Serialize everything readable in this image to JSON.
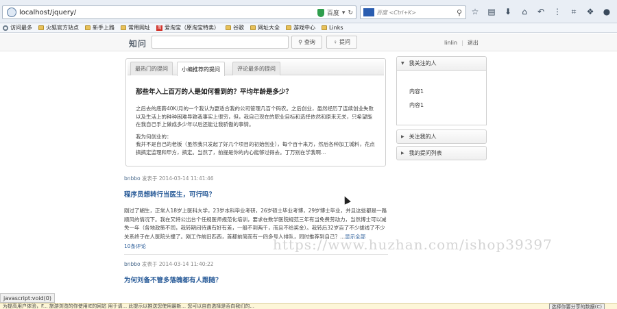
{
  "browser": {
    "url": "localhost/jquery/",
    "search_placeholder": "百度 <Ctrl+K>",
    "url_action": "百度"
  },
  "bookmarks": [
    {
      "label": "访问最多",
      "icon": "gear"
    },
    {
      "label": "火狐官方站点",
      "icon": "folder"
    },
    {
      "label": "新手上路",
      "icon": "folder"
    },
    {
      "label": "常用网址",
      "icon": "folder"
    },
    {
      "label": "爱淘宝（原淘宝特卖）",
      "icon": "taobao"
    },
    {
      "label": "谷歌",
      "icon": "folder"
    },
    {
      "label": "网址大全",
      "icon": "folder"
    },
    {
      "label": "游戏中心",
      "icon": "folder"
    },
    {
      "label": "Links",
      "icon": "folder"
    }
  ],
  "site": {
    "logo": "知问",
    "search_button": "查询",
    "ask_button": "提问",
    "username": "linlin",
    "logout": "退出"
  },
  "tabs": [
    {
      "label": "最热门的提问"
    },
    {
      "label": "小编推荐的提问"
    },
    {
      "label": "评论最多的提问"
    }
  ],
  "featured": {
    "title": "那些年入上百万的人是如何看到的？平均年龄是多少？",
    "para1": "之后去的底薪40K/月的一个我认为更适合我的公司管理几百个码农。之后创业，虽然经历了连续创业失败以及生活上的种种困难导致我事实上很穷，但，我自己现在的职业目标和选择依然和原来无关，只希望能在我自己手上做成多少年以后还能让我骄傲的事情。",
    "para2": "我为何创业的：",
    "para3": "我并不是自己的老板（虽然我只发起了好几个项目的初始创业），每个百十来万，然后各种加工城料，花点搞搞定监理和甲方，搞定。当然了，前提是你的内心能够过得去。丁万别在学我啊…"
  },
  "feed": [
    {
      "author": "bnbbo",
      "verb": "发表于",
      "time": "2014-03-14 11:41:46",
      "title": "程序员想转行当医生，可行吗？",
      "body": "刚过了糊生，正常人18岁上医科大学，23岁本科毕业考研，26岁硕士毕业考博，29岁博士毕业，并且这些都是一路顺风的情况下。我在又特公出台个任规医师规范化培训，要求在数学医院规范三年有当免费劳动力，当然博士可以减免一年（各地政策不同，我转期间待遇有好有差，一般不到两千，而且不给奖金）。我转后32岁百了不少拔线了不少关系终于在人医院头撞了。刚工作前旧匹西，首都前简而有一四多号人排队，同时推荐到自己？...",
      "more": "显示全部",
      "comments": "10条评论"
    },
    {
      "author": "bnbbo",
      "verb": "发表于",
      "time": "2014-03-14 11:40:22",
      "title": "为何刘备不管多落魄都有人跟随？"
    }
  ],
  "sidebar": {
    "sections": [
      {
        "label": "我关注的人",
        "open": true,
        "items": [
          "内容1",
          "内容1"
        ]
      },
      {
        "label": "关注我的人",
        "open": false
      },
      {
        "label": "我的提问列表",
        "open": false
      }
    ]
  },
  "watermark": "https://www.huzhan.com/ishop39397",
  "status": {
    "text": "javascript:void(0)",
    "bottom_notice": "为提高用户体验，F... 旅游浏览的你使用IE的网站 用于请... 此提示以推送您使用最新... 您可以自由选择是否向我们的...",
    "bottom_button": "选择你要分享的数据(C)"
  }
}
